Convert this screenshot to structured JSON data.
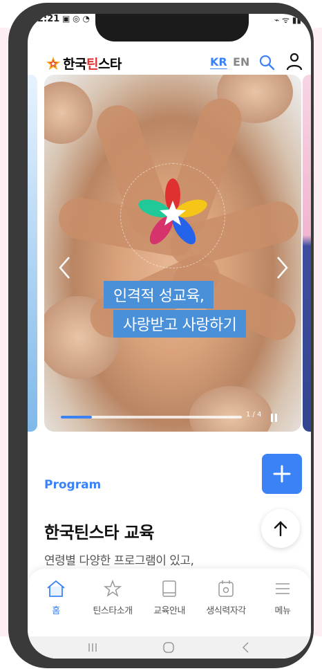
{
  "status": {
    "time": "2:21",
    "left_icons": "▣ ◎ ◔",
    "right_icons": "⌁ ᯤ ▮▮"
  },
  "header": {
    "logo_text_1": "한국",
    "logo_text_2": "틴",
    "logo_text_3": "스타",
    "lang_kr": "KR",
    "lang_en": "EN",
    "icons": [
      "search-icon",
      "user-icon"
    ]
  },
  "carousel": {
    "line1": "인격적 성교육,",
    "line2": "사랑받고 사랑하기",
    "counter": "1 / 4",
    "progress": 0.17
  },
  "section": {
    "label": "Program",
    "title": "한국틴스타 교육",
    "description": "연령별 다양한 프로그램이 있고,"
  },
  "nav": {
    "items": [
      {
        "label": "홈",
        "icon": "home-icon",
        "active": true
      },
      {
        "label": "틴스타소개",
        "icon": "star-icon",
        "active": false
      },
      {
        "label": "교육안내",
        "icon": "book-icon",
        "active": false
      },
      {
        "label": "생식력자각",
        "icon": "calendar-icon",
        "active": false
      },
      {
        "label": "메뉴",
        "icon": "menu-icon",
        "active": false
      }
    ]
  },
  "colors": {
    "accent": "#3b82f6",
    "banner": "#4a90d9",
    "logo_red": "#e03131"
  }
}
